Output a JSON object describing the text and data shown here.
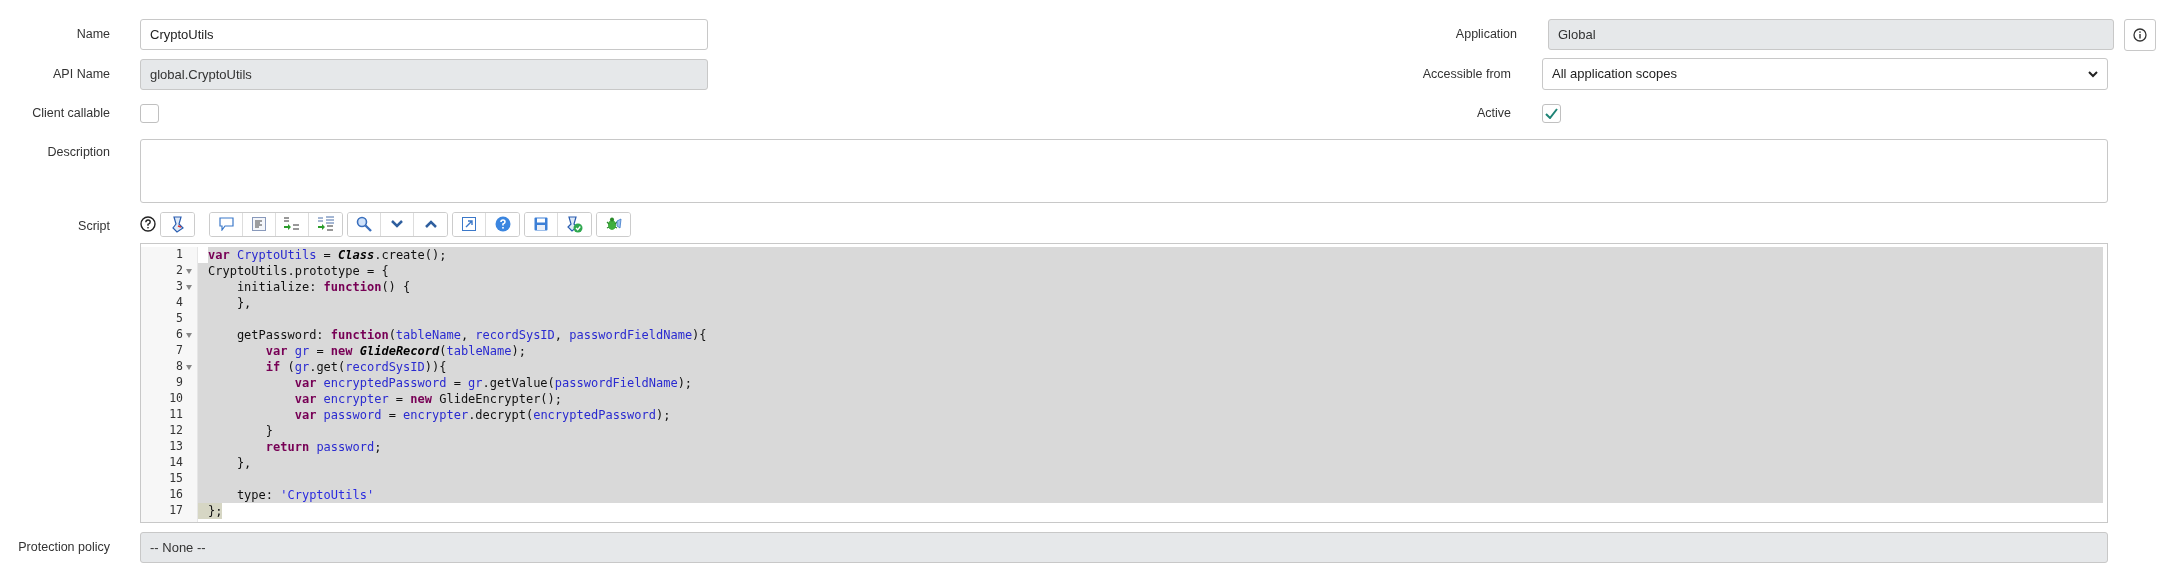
{
  "name": {
    "label": "Name",
    "value": "CryptoUtils"
  },
  "api_name": {
    "label": "API Name",
    "value": "global.CryptoUtils"
  },
  "client_callable": {
    "label": "Client callable",
    "checked": false
  },
  "application": {
    "label": "Application",
    "value": "Global"
  },
  "accessible_from": {
    "label": "Accessible from",
    "value": "All application scopes"
  },
  "active": {
    "label": "Active",
    "checked": true
  },
  "description": {
    "label": "Description"
  },
  "script": {
    "label": "Script",
    "selected": true,
    "lines": [
      {
        "number": "1",
        "fold": false,
        "tokens": [
          {
            "kind": "keyword",
            "text": "var"
          },
          {
            "kind": "variable",
            "text": " CryptoUtils"
          },
          {
            "kind": "plain",
            "text": " = "
          },
          {
            "kind": "class",
            "text": "Class"
          },
          {
            "kind": "plain",
            "text": ".create();"
          }
        ]
      },
      {
        "number": "2",
        "fold": true,
        "tokens": [
          {
            "kind": "plain",
            "text": "CryptoUtils.prototype = {"
          }
        ]
      },
      {
        "number": "3",
        "fold": true,
        "tokens": [
          {
            "kind": "plain",
            "text": "    initialize: "
          },
          {
            "kind": "keyword",
            "text": "function"
          },
          {
            "kind": "plain",
            "text": "() {"
          }
        ]
      },
      {
        "number": "4",
        "fold": false,
        "tokens": [
          {
            "kind": "plain",
            "text": "    },"
          }
        ]
      },
      {
        "number": "5",
        "fold": false
      },
      {
        "number": "6",
        "fold": true,
        "tokens": [
          {
            "kind": "plain",
            "text": "    getPassword: "
          },
          {
            "kind": "keyword",
            "text": "function"
          },
          {
            "kind": "plain",
            "text": "("
          },
          {
            "kind": "variable",
            "text": "tableName"
          },
          {
            "kind": "plain",
            "text": ", "
          },
          {
            "kind": "variable",
            "text": "recordSysID"
          },
          {
            "kind": "plain",
            "text": ", "
          },
          {
            "kind": "variable",
            "text": "passwordFieldName"
          },
          {
            "kind": "plain",
            "text": "){"
          }
        ]
      },
      {
        "number": "7",
        "fold": false,
        "tokens": [
          {
            "kind": "keyword",
            "text": "        var"
          },
          {
            "kind": "variable",
            "text": " gr"
          },
          {
            "kind": "plain",
            "text": " = "
          },
          {
            "kind": "keyword",
            "text": "new"
          },
          {
            "kind": "class",
            "text": " GlideRecord"
          },
          {
            "kind": "plain",
            "text": "("
          },
          {
            "kind": "variable",
            "text": "tableName"
          },
          {
            "kind": "plain",
            "text": ");"
          }
        ]
      },
      {
        "number": "8",
        "fold": true,
        "tokens": [
          {
            "kind": "keyword",
            "text": "        if"
          },
          {
            "kind": "plain",
            "text": " ("
          },
          {
            "kind": "variable",
            "text": "gr"
          },
          {
            "kind": "plain",
            "text": ".get("
          },
          {
            "kind": "variable",
            "text": "recordSysID"
          },
          {
            "kind": "plain",
            "text": ")){"
          }
        ]
      },
      {
        "number": "9",
        "fold": false,
        "tokens": [
          {
            "kind": "keyword",
            "text": "            var"
          },
          {
            "kind": "variable",
            "text": " encryptedPassword"
          },
          {
            "kind": "plain",
            "text": " = "
          },
          {
            "kind": "variable",
            "text": "gr"
          },
          {
            "kind": "plain",
            "text": ".getValue("
          },
          {
            "kind": "variable",
            "text": "passwordFieldName"
          },
          {
            "kind": "plain",
            "text": ");"
          }
        ]
      },
      {
        "number": "10",
        "fold": false,
        "tokens": [
          {
            "kind": "keyword",
            "text": "            var"
          },
          {
            "kind": "variable",
            "text": " encrypter"
          },
          {
            "kind": "plain",
            "text": " = "
          },
          {
            "kind": "keyword",
            "text": "new"
          },
          {
            "kind": "plain",
            "text": " GlideEncrypter();"
          }
        ]
      },
      {
        "number": "11",
        "fold": false,
        "tokens": [
          {
            "kind": "keyword",
            "text": "            var"
          },
          {
            "kind": "variable",
            "text": " password"
          },
          {
            "kind": "plain",
            "text": " = "
          },
          {
            "kind": "variable",
            "text": "encrypter"
          },
          {
            "kind": "plain",
            "text": ".decrypt("
          },
          {
            "kind": "variable",
            "text": "encryptedPassword"
          },
          {
            "kind": "plain",
            "text": ");"
          }
        ]
      },
      {
        "number": "12",
        "fold": false,
        "tokens": [
          {
            "kind": "plain",
            "text": "        }"
          }
        ]
      },
      {
        "number": "13",
        "fold": false,
        "tokens": [
          {
            "kind": "keyword",
            "text": "        return"
          },
          {
            "kind": "variable",
            "text": " password"
          },
          {
            "kind": "plain",
            "text": ";"
          }
        ]
      },
      {
        "number": "14",
        "fold": false,
        "tokens": [
          {
            "kind": "plain",
            "text": "    },"
          }
        ]
      },
      {
        "number": "15",
        "fold": false
      },
      {
        "number": "16",
        "fold": false,
        "tokens": [
          {
            "kind": "plain",
            "text": "    type: "
          },
          {
            "kind": "string",
            "text": "'CryptoUtils'"
          }
        ]
      },
      {
        "number": "17",
        "fold": false,
        "tokens": [
          {
            "kind": "plain",
            "text": "};"
          }
        ]
      }
    ]
  },
  "protection_policy": {
    "label": "Protection policy",
    "value": "-- None --"
  }
}
